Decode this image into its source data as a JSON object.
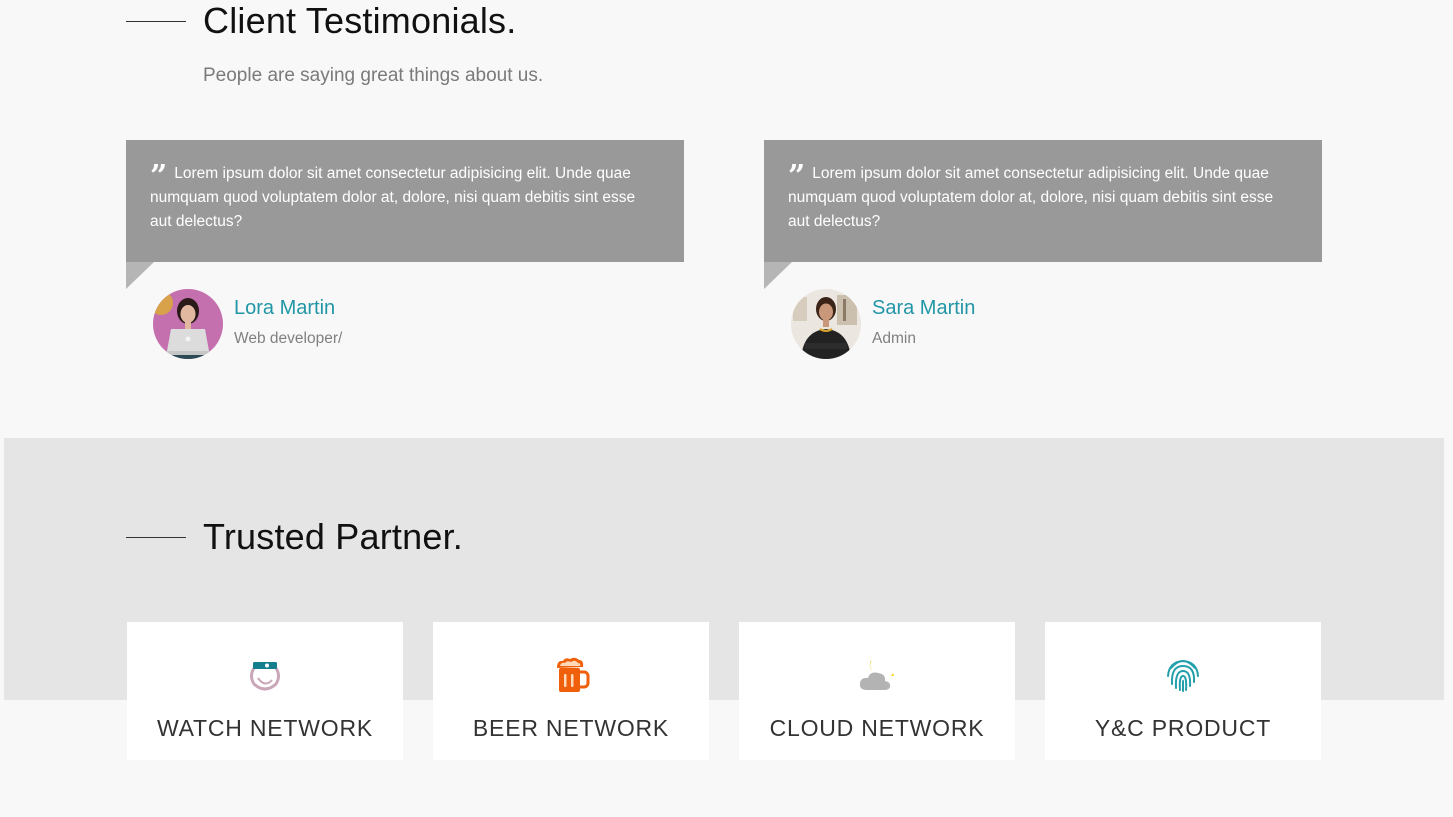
{
  "testimonials": {
    "title": "Client Testimonials.",
    "subtitle": "People are saying great things about us.",
    "items": [
      {
        "quote": "Lorem ipsum dolor sit amet consectetur adipisicing elit. Unde quae numquam quod voluptatem dolor at, dolore, nisi quam debitis sint esse aut delectus?",
        "name": "Lora Martin",
        "role": "Web developer/",
        "avatar_icon": "woman-with-laptop-avatar"
      },
      {
        "quote": "Lorem ipsum dolor sit amet consectetur adipisicing elit. Unde quae numquam quod voluptatem dolor at, dolore, nisi quam debitis sint esse aut delectus?",
        "name": "Sara Martin",
        "role": "Admin",
        "avatar_icon": "woman-standing-avatar"
      }
    ],
    "quote_mark": "❞"
  },
  "partners": {
    "title": "Trusted Partner.",
    "items": [
      {
        "label": "WATCH NETWORK",
        "icon": "watch-icon"
      },
      {
        "label": "BEER NETWORK",
        "icon": "beer-mug-icon"
      },
      {
        "label": "CLOUD NETWORK",
        "icon": "cloud-moon-icon"
      },
      {
        "label": "Y&C PRODUCT",
        "icon": "fingerprint-icon"
      }
    ]
  },
  "colors": {
    "accent": "#2196a6",
    "quote_bg": "#999999",
    "band_bg": "#e5e5e5",
    "beer": "#f0600a",
    "cloud": "#b0b0b0",
    "moon": "#f5d21e"
  }
}
